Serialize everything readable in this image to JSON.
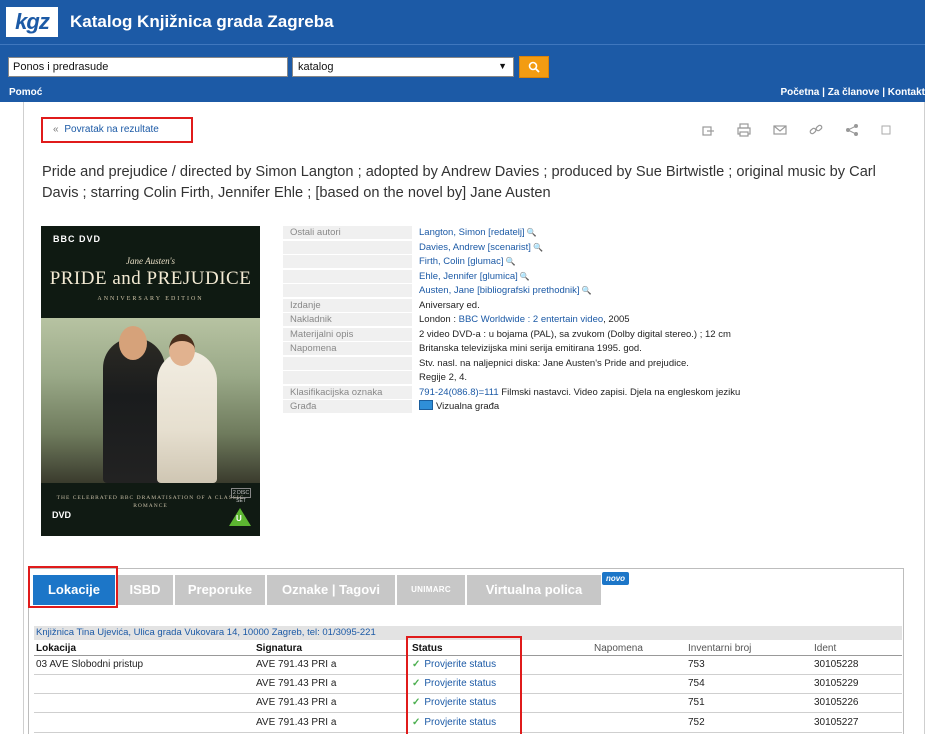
{
  "header": {
    "logo": "kgz",
    "title": "Katalog Knjižnica grada Zagreba"
  },
  "search": {
    "query": "Ponos i predrasude",
    "scope": "katalog"
  },
  "nav": {
    "help": "Pomoć",
    "right": "Početna | Za članove | Kontakt"
  },
  "back_link": "Povratak na rezultate",
  "record": {
    "title": "Pride and prejudice / directed by Simon Langton ; adopted by Andrew Davies ; produced by Sue Birtwistle ; original music by Carl Davis ; starring Colin Firth, Jennifer Ehle ; [based on the novel by] Jane Austen",
    "cover": {
      "brand": "BBC DVD",
      "author": "Jane Austen's",
      "title": "PRIDE and PREJUDICE",
      "edition": "ANNIVERSARY EDITION",
      "tagline": "THE CELEBRATED BBC DRAMATISATION OF A CLASSIC ROMANCE",
      "dvd": "DVD",
      "rating": "U"
    },
    "fields": [
      {
        "label": "Ostali autori",
        "value": "Langton, Simon",
        "role": " [redatelj]",
        "link": true,
        "search": true
      },
      {
        "label": "",
        "value": "Davies, Andrew",
        "role": " [scenarist]",
        "link": true,
        "search": true
      },
      {
        "label": "",
        "value": "Firth, Colin",
        "role": " [glumac]",
        "link": true,
        "search": true
      },
      {
        "label": "",
        "value": "Ehle, Jennifer",
        "role": " [glumica]",
        "link": true,
        "search": true
      },
      {
        "label": "",
        "value": "Austen, Jane",
        "role": " [bibliografski prethodnik]",
        "link": true,
        "search": true
      },
      {
        "label": "Izdanje",
        "value": "Aniversary ed."
      },
      {
        "label": "Nakladnik",
        "value_prefix": "London : ",
        "value": "BBC Worldwide : 2 entertain video",
        "value_suffix": ", 2005",
        "link": true
      },
      {
        "label": "Materijalni opis",
        "value": "2 video DVD-a : u bojama (PAL), sa zvukom (Dolby digital stereo.) ; 12 cm"
      },
      {
        "label": "Napomena",
        "value": "Britanska televizijska mini serija emitirana 1995. god."
      },
      {
        "label": "",
        "value": "Stv. nasl. na naljepnici diska: Jane Austen's Pride and prejudice."
      },
      {
        "label": "",
        "value": "Regije 2, 4."
      },
      {
        "label": "Klasifikacijska oznaka",
        "value": "791-24(086.8)=111",
        "value_suffix": " Filmski nastavci. Video zapisi. Djela na engleskom jeziku",
        "link": true
      },
      {
        "label": "Građa",
        "value": "Vizualna građa",
        "icon": "monitor-icon"
      }
    ]
  },
  "tabs": [
    {
      "label": "Lokacije",
      "active": true
    },
    {
      "label": "ISBD"
    },
    {
      "label": "Preporuke"
    },
    {
      "label": "Oznake | Tagovi"
    },
    {
      "label": "UNIMARC"
    },
    {
      "label": "Virtualna polica"
    }
  ],
  "new_badge": "novo",
  "holdings": {
    "library": "Knjižnica Tina Ujevića, Ulica grada Vukovara 14, 10000 Zagreb, tel: 01/3095-221",
    "columns": [
      "Lokacija",
      "Signatura",
      "Status",
      "Napomena",
      "Inventarni broj",
      "Ident"
    ],
    "rows": [
      {
        "lokacija": "03 AVE Slobodni pristup",
        "signatura": "AVE 791.43 PRI a",
        "status": "Provjerite status",
        "napomena": "",
        "inventarni": "753",
        "ident": "30105228"
      },
      {
        "lokacija": "",
        "signatura": "AVE 791.43 PRI a",
        "status": "Provjerite status",
        "napomena": "",
        "inventarni": "754",
        "ident": "30105229"
      },
      {
        "lokacija": "",
        "signatura": "AVE 791.43 PRI a",
        "status": "Provjerite status",
        "napomena": "",
        "inventarni": "751",
        "ident": "30105226"
      },
      {
        "lokacija": "",
        "signatura": "AVE 791.43 PRI a",
        "status": "Provjerite status",
        "napomena": "",
        "inventarni": "752",
        "ident": "30105227"
      }
    ]
  },
  "colors": {
    "brand": "#1c5aa6",
    "accent": "#f39c12",
    "highlight": "#e01b1b",
    "tab_active": "#1c76c8",
    "tab_inactive": "#c7c7c7"
  }
}
